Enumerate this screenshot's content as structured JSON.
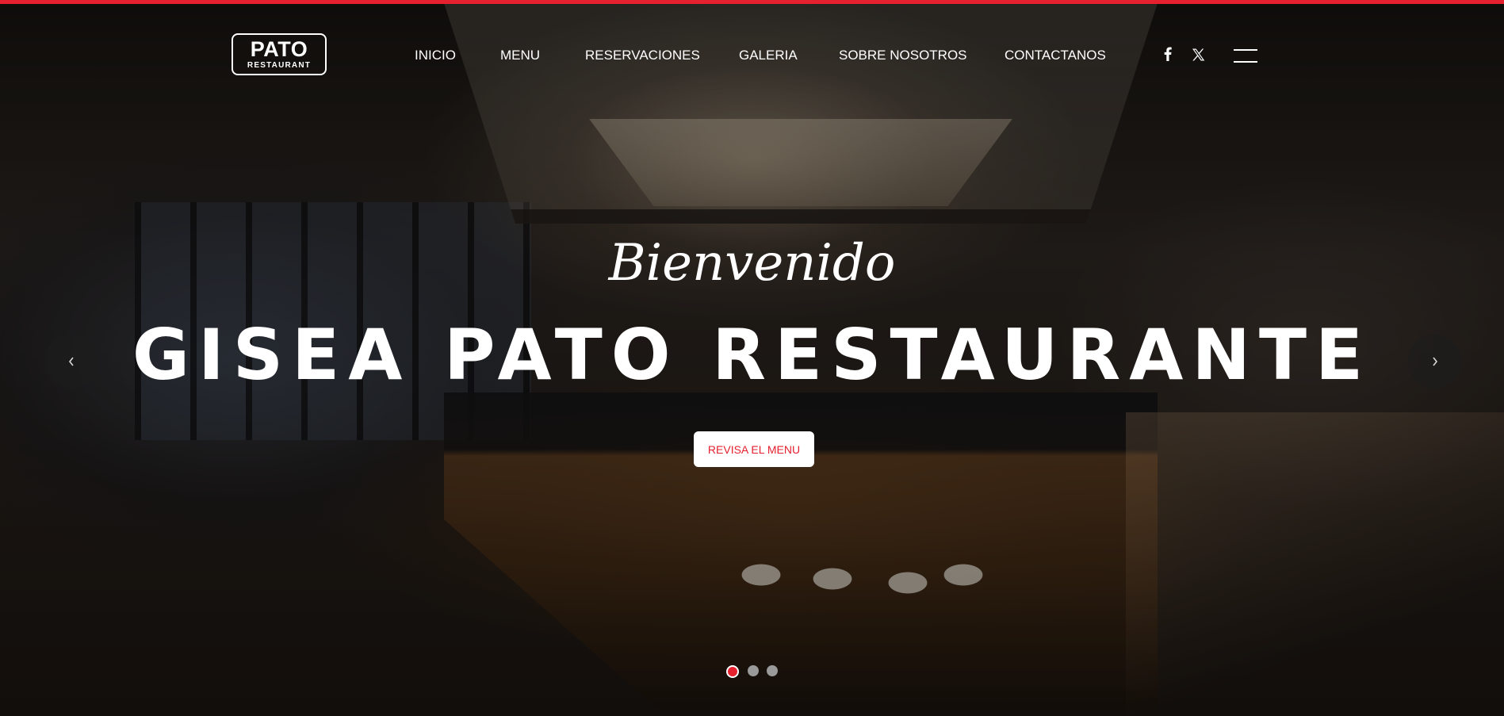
{
  "theme": {
    "accent": "#e5202f",
    "text": "#ffffff",
    "dot_inactive": "#9a9a9a"
  },
  "logo": {
    "main": "PATO",
    "sub": "RESTAURANT"
  },
  "nav": {
    "items": [
      {
        "label": "INICIO"
      },
      {
        "label": "MENU"
      },
      {
        "label": "RESERVACIONES"
      },
      {
        "label": "GALERIA"
      },
      {
        "label": "SOBRE NOSOTROS"
      },
      {
        "label": "CONTACTANOS"
      }
    ],
    "social": [
      {
        "icon": "facebook-icon"
      },
      {
        "icon": "x-twitter-icon"
      }
    ],
    "menu_icon": "hamburger-menu-icon"
  },
  "hero": {
    "script": "Bienvenido",
    "title": "GISEA PATO RESTAURANTE",
    "cta_label": "REVISA EL MENU",
    "prev_icon": "chevron-left-icon",
    "next_icon": "chevron-right-icon",
    "slides": {
      "count": 3,
      "active": 1
    }
  }
}
